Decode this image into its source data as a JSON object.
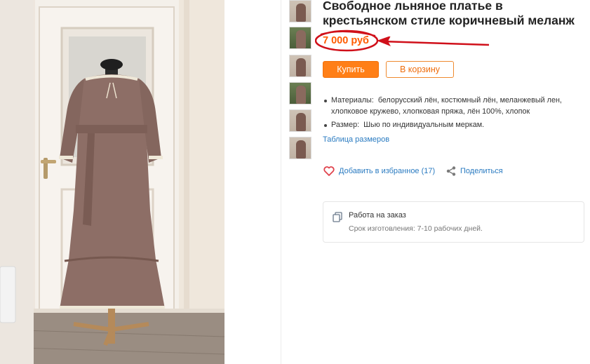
{
  "product": {
    "title_line1": "Свободное льняное платье в",
    "title_line2": "крестьянском стиле коричневый меланж",
    "price": "7 000 руб",
    "buy_label": "Купить",
    "cart_label": "В корзину",
    "properties": [
      {
        "key": "Материалы:",
        "value": "белорусский лён, костюмный лён, меланжевый лен, хлопковое кружево, хлопковая пряжа, лён 100%, хлопок"
      },
      {
        "key": "Размер:",
        "value": "Шью по индивидуальным меркам."
      }
    ],
    "size_table_link": "Таблица размеров",
    "favorite_label": "Добавить в избранное (17)",
    "share_label": "Поделиться",
    "order_card": {
      "title": "Работа на заказ",
      "subtitle": "Срок изготовления: 7-10 рабочих дней."
    }
  },
  "colors": {
    "price": "#ff5b00",
    "buy_button": "#ff7f17",
    "link": "#2a7bc1",
    "annotation": "#d0101a"
  },
  "icons": {
    "favorite": "heart-icon",
    "share": "share-icon",
    "order": "copy-icon"
  },
  "thumbnails_count": 6
}
